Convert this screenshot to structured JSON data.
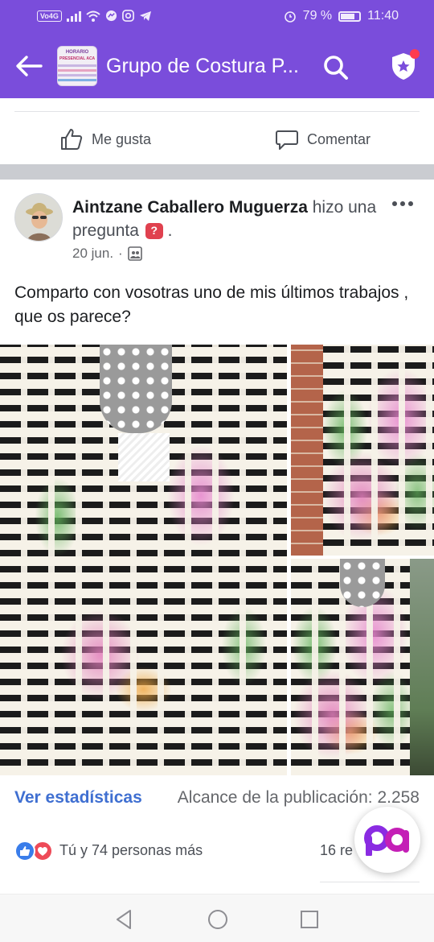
{
  "status_bar": {
    "volte": "Vo4G",
    "battery": "79 %",
    "battery_level": 0.79,
    "time": "11:40"
  },
  "app_bar": {
    "title": "Grupo de Costura P...",
    "group_thumb_text": "HORARIO",
    "group_thumb_subtext": "PRESENCIAL ACADEMIA"
  },
  "previous_post": {
    "like_label": "Me gusta",
    "comment_label": "Comentar"
  },
  "post": {
    "author": "Aintzane Caballero Muguerza",
    "action_text_1": "hizo",
    "action_text_2": "una pregunta",
    "question_badge": "?",
    "action_end": ".",
    "date": "20 jun.",
    "meta_separator": "·",
    "text": "Comparto con vosotras uno de mis últimos trabajos , que os parece?"
  },
  "stats": {
    "link": "Ver estadísticas",
    "reach": "Alcance de la publicación: 2.258"
  },
  "reactions": {
    "summary": "Tú y 74 personas más",
    "count_partial": "16 re"
  },
  "colors": {
    "brand_purple": "#7a4ddb",
    "link_blue": "#3f6fd1",
    "like_blue": "#3a7dea",
    "love_red": "#ee4a58",
    "badge_red": "#e0414f"
  },
  "icons": {
    "back": "back-arrow-icon",
    "search": "search-icon",
    "shield": "admin-shield-icon",
    "like": "thumbs-up-icon",
    "comment": "comment-bubble-icon",
    "more": "more-horizontal-icon",
    "audience": "group-audience-icon",
    "fab": "pa-app-icon",
    "nav_back": "triangle-back-icon",
    "nav_home": "circle-home-icon",
    "nav_recents": "square-recents-icon"
  }
}
